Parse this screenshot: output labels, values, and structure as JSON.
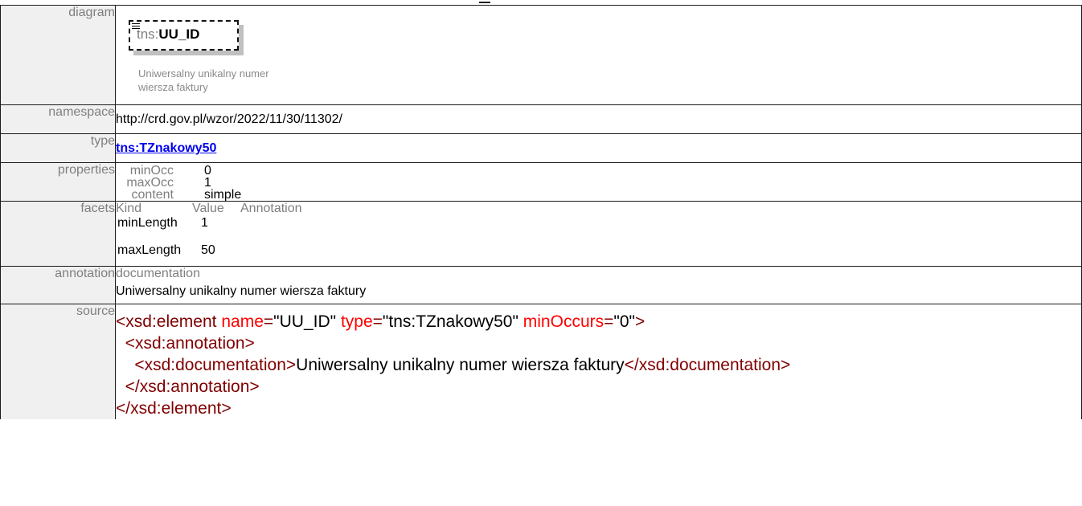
{
  "rows": {
    "diagram": {
      "label": "diagram"
    },
    "namespace": {
      "label": "namespace",
      "value": "http://crd.gov.pl/wzor/2022/11/30/11302/"
    },
    "type": {
      "label": "type",
      "value": "tns:TZnakowy50"
    },
    "properties": {
      "label": "properties",
      "items": [
        {
          "key": "minOcc",
          "value": "0"
        },
        {
          "key": "maxOcc",
          "value": "1"
        },
        {
          "key": "content",
          "value": "simple"
        }
      ]
    },
    "facets": {
      "label": "facets",
      "headers": {
        "kind": "Kind",
        "value": "Value",
        "annotation": "Annotation"
      },
      "items": [
        {
          "kind": "minLength",
          "value": "1"
        },
        {
          "kind": "maxLength",
          "value": "50"
        }
      ]
    },
    "annotation": {
      "label": "annotation",
      "heading": "documentation",
      "text": "Uniwersalny unikalny numer wiersza faktury"
    },
    "source": {
      "label": "source",
      "open_tag": "xsd:element",
      "attr_name": "name",
      "attr_name_val": "UU_ID",
      "attr_type": "type",
      "attr_type_val": "tns:TZnakowy50",
      "attr_min": "minOccurs",
      "attr_min_val": "0",
      "annotation_tag": "xsd:annotation",
      "documentation_tag": "xsd:documentation",
      "documentation_text": "Uniwersalny unikalny numer wiersza faktury"
    }
  },
  "diagram": {
    "prefix": "tns:",
    "element_name": "UU_ID",
    "doc_line1": "Uniwersalny unikalny numer",
    "doc_line2": "wiersza faktury",
    "icon": "lines-icon"
  }
}
